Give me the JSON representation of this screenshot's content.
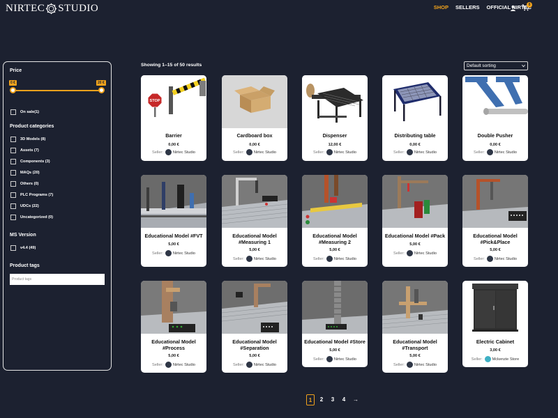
{
  "header": {
    "logo_left": "NIRTEC",
    "logo_right": "STUDIO",
    "nav": [
      {
        "label": "SHOP",
        "active": true
      },
      {
        "label": "SELLERS",
        "active": false
      },
      {
        "label": "OFFICIAL NIRTEC",
        "active": false
      }
    ],
    "cart_count": "0"
  },
  "sidebar": {
    "price_title": "Price",
    "price_min": "0 €",
    "price_max": "20 €",
    "on_sale": "On sale(1)",
    "categories_title": "Product categories",
    "categories": [
      "3D Models (8)",
      "Assets (7)",
      "Components (3)",
      "MAQs (20)",
      "Others (0)",
      "PLC Programs (7)",
      "UDCs (22)",
      "Uncategorized (0)"
    ],
    "ms_title": "MS Version",
    "ms_versions": [
      "v4.4 (49)"
    ],
    "tags_title": "Product tags",
    "tags_placeholder": "Product tags"
  },
  "results_text": "Showing 1–15 of 50 results",
  "sort_selected": "Default sorting",
  "products": [
    {
      "title": "Barrier",
      "price": "0,00 €",
      "seller_label": "Seller:",
      "seller": "Nirtec Studio",
      "image": "barrier"
    },
    {
      "title": "Cardboard box",
      "price": "0,00 €",
      "seller_label": "Seller:",
      "seller": "Nirtec Studio",
      "image": "box"
    },
    {
      "title": "Dispenser",
      "price": "12,00 €",
      "seller_label": "Seller:",
      "seller": "Nirtec Studio",
      "image": "dispenser"
    },
    {
      "title": "Distributing table",
      "price": "0,00 €",
      "seller_label": "Seller:",
      "seller": "Nirtec Studio",
      "image": "table"
    },
    {
      "title": "Double Pusher",
      "price": "0,00 €",
      "seller_label": "Seller:",
      "seller": "Nirtec Studio",
      "image": "pusher"
    },
    {
      "title": "Educational Model #FVT",
      "price": "5,00 €",
      "seller_label": "Seller:",
      "seller": "Nirtec Studio",
      "image": "model"
    },
    {
      "title": "Educational Model #Measuring 1",
      "price": "5,00 €",
      "seller_label": "Seller:",
      "seller": "Nirtec Studio",
      "image": "model"
    },
    {
      "title": "Educational Model #Measuring 2",
      "price": "5,00 €",
      "seller_label": "Seller:",
      "seller": "Nirtec Studio",
      "image": "model"
    },
    {
      "title": "Educational Model #Pack",
      "price": "5,00 €",
      "seller_label": "Seller:",
      "seller": "Nirtec Studio",
      "image": "model"
    },
    {
      "title": "Educational Model #Pick&Place",
      "price": "5,00 €",
      "seller_label": "Seller:",
      "seller": "Nirtec Studio",
      "image": "model"
    },
    {
      "title": "Educational Model #Process",
      "price": "5,00 €",
      "seller_label": "Seller:",
      "seller": "Nirtec Studio",
      "image": "model"
    },
    {
      "title": "Educational Model #Separation",
      "price": "5,00 €",
      "seller_label": "Seller:",
      "seller": "Nirtec Studio",
      "image": "model"
    },
    {
      "title": "Educational Model #Store",
      "price": "5,00 €",
      "seller_label": "Seller:",
      "seller": "Nirtec Studio",
      "image": "model"
    },
    {
      "title": "Educational Model #Transport",
      "price": "5,00 €",
      "seller_label": "Seller:",
      "seller": "Nirtec Studio",
      "image": "model"
    },
    {
      "title": "Electric Cabinet",
      "price": "3,00 €",
      "seller_label": "Seller:",
      "seller": "Mckenzie Store",
      "image": "cabinet"
    }
  ],
  "pagination": [
    "1",
    "2",
    "3",
    "4",
    "→"
  ],
  "colors": {
    "background": "#1c2130",
    "accent": "#f0a21c",
    "card": "#ffffff"
  }
}
